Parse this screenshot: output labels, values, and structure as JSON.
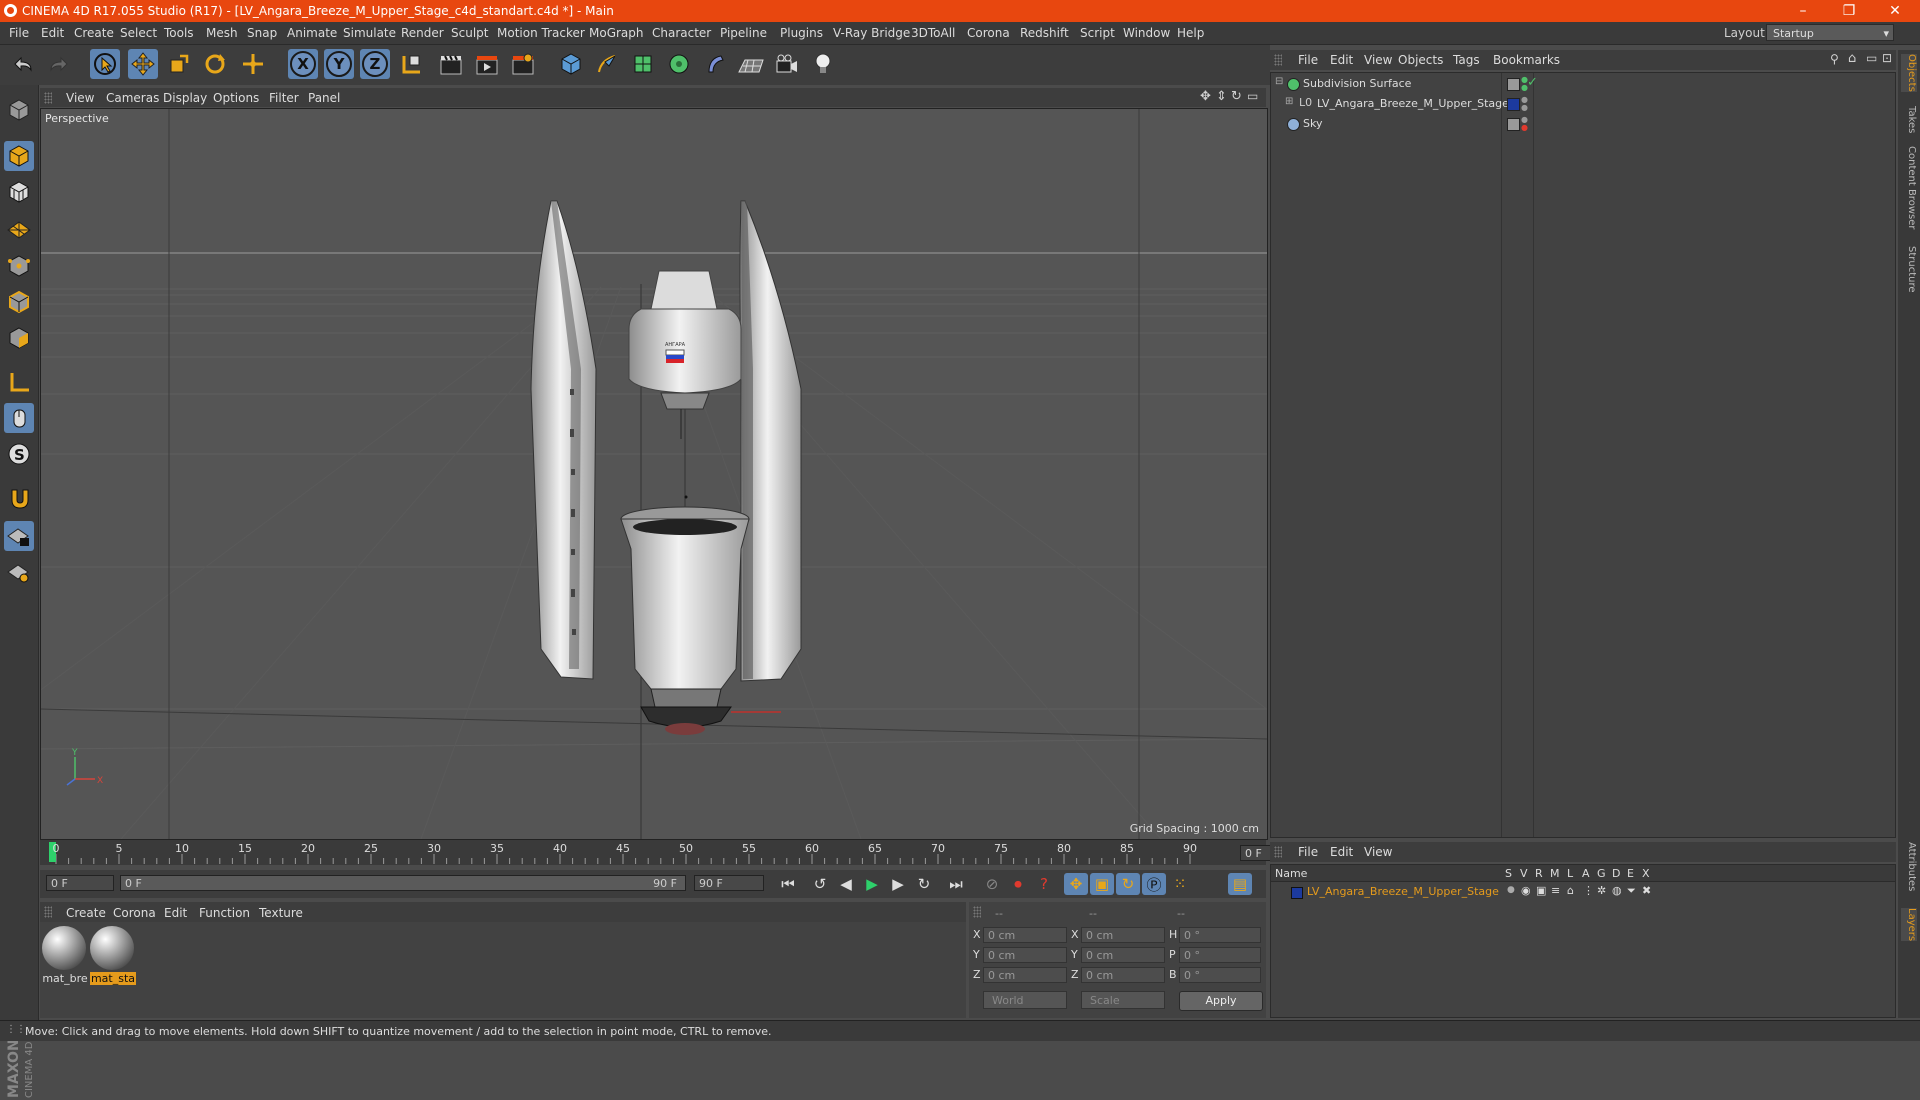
{
  "window": {
    "title": "CINEMA 4D R17.055 Studio (R17) - [LV_Angara_Breeze_M_Upper_Stage_c4d_standart.c4d *] - Main",
    "minimize": "–",
    "restore": "❐",
    "close": "✕"
  },
  "menubar": {
    "items": [
      "File",
      "Edit",
      "Create",
      "Select",
      "Tools",
      "Mesh",
      "Snap",
      "Animate",
      "Simulate",
      "Render",
      "Sculpt",
      "Motion Tracker",
      "MoGraph",
      "Character",
      "Pipeline",
      "Plugins",
      "V-Ray Bridge",
      "3DToAll",
      "Corona",
      "Redshift",
      "Script",
      "Window",
      "Help"
    ],
    "layout_label": "Layout:",
    "layout_value": "Startup"
  },
  "toolbar": {
    "axis_x": "X",
    "axis_y": "Y",
    "axis_z": "Z"
  },
  "viewport": {
    "menu": [
      "View",
      "Cameras",
      "Display",
      "Options",
      "Filter",
      "Panel"
    ],
    "label": "Perspective",
    "grid_spacing": "Grid Spacing : 1000 cm",
    "axis_x": "X",
    "axis_y": "Y",
    "flag_text": "АНГАРА"
  },
  "timeline": {
    "ticks": [
      "0",
      "5",
      "10",
      "15",
      "20",
      "25",
      "30",
      "35",
      "40",
      "45",
      "50",
      "55",
      "60",
      "65",
      "70",
      "75",
      "80",
      "85",
      "90"
    ],
    "current_frame": "0 F"
  },
  "transport": {
    "start_field": "0 F",
    "range_start": "0 F",
    "range_end": "90 F",
    "end_field": "90 F"
  },
  "materials": {
    "menu": [
      "Create",
      "Corona",
      "Edit",
      "Function",
      "Texture"
    ],
    "items": [
      {
        "label": "mat_bre",
        "selected": false
      },
      {
        "label": "mat_sta",
        "selected": true
      }
    ],
    "logo_line1": "MAXON",
    "logo_line2": "CINEMA 4D"
  },
  "coordinates": {
    "headers": [
      "--",
      "--",
      "--"
    ],
    "rows": [
      {
        "a": "X",
        "av": "0 cm",
        "b": "X",
        "bv": "0 cm",
        "c": "H",
        "cv": "0 °"
      },
      {
        "a": "Y",
        "av": "0 cm",
        "b": "Y",
        "bv": "0 cm",
        "c": "P",
        "cv": "0 °"
      },
      {
        "a": "Z",
        "av": "0 cm",
        "b": "Z",
        "bv": "0 cm",
        "c": "B",
        "cv": "0 °"
      }
    ],
    "mode_world": "World",
    "mode_scale": "Scale",
    "apply": "Apply"
  },
  "object_manager": {
    "menu": [
      "File",
      "Edit",
      "View",
      "Objects",
      "Tags",
      "Bookmarks"
    ],
    "objects": [
      {
        "name": "Subdivision Surface",
        "color": "#4fc06a"
      },
      {
        "name": "LV_Angara_Breeze_M_Upper_Stage",
        "color": "#dddddd"
      },
      {
        "name": "Sky",
        "color": "#8fb0d8"
      }
    ]
  },
  "layer_manager": {
    "menu": [
      "File",
      "Edit",
      "View"
    ],
    "header_name": "Name",
    "columns": [
      "S",
      "V",
      "R",
      "M",
      "L",
      "A",
      "G",
      "D",
      "E",
      "X"
    ],
    "layer": {
      "name": "LV_Angara_Breeze_M_Upper_Stage",
      "color": "#1c3a9e"
    }
  },
  "side_tabs": [
    "Objects",
    "Takes",
    "Content Browser",
    "Structure",
    "Attributes",
    "Layers"
  ],
  "status": {
    "text": "Move: Click and drag to move elements. Hold down SHIFT to quantize movement / add to the selection in point mode, CTRL to remove."
  },
  "colors": {
    "titlebar": "#e8470f",
    "accent_orange": "#e59b1c",
    "active_blue": "#5e85b3"
  }
}
